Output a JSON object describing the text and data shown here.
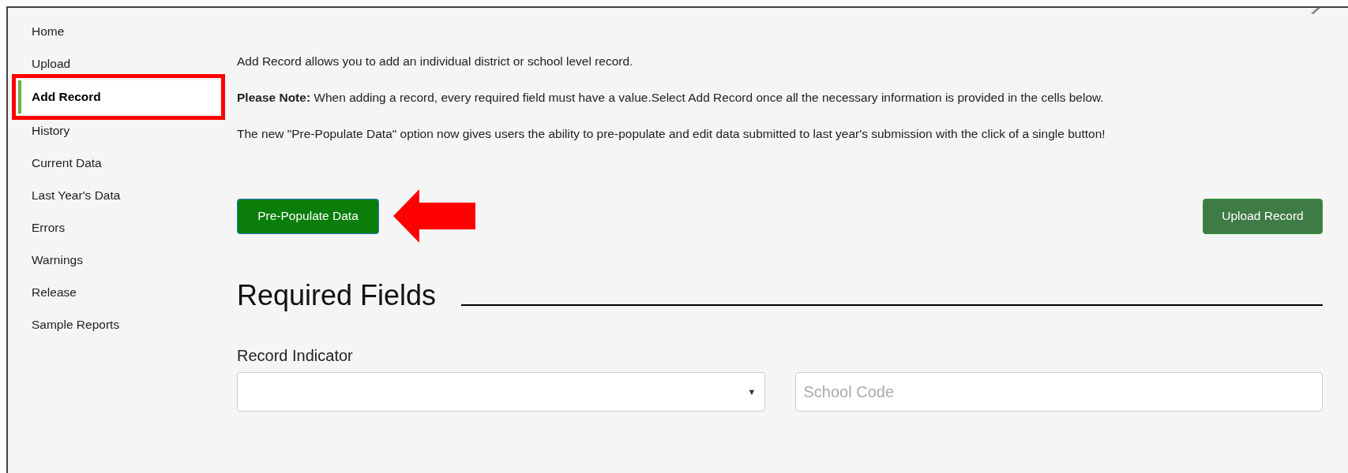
{
  "sidebar": {
    "items": [
      {
        "label": "Home",
        "selected": false
      },
      {
        "label": "Upload",
        "selected": false
      },
      {
        "label": "Add Record",
        "selected": true
      },
      {
        "label": "History",
        "selected": false
      },
      {
        "label": "Current Data",
        "selected": false
      },
      {
        "label": "Last Year's Data",
        "selected": false
      },
      {
        "label": "Errors",
        "selected": false
      },
      {
        "label": "Warnings",
        "selected": false
      },
      {
        "label": "Release",
        "selected": false
      },
      {
        "label": "Sample Reports",
        "selected": false
      }
    ]
  },
  "intro": [
    "Add Record allows you to add an individual district or school level record.",
    "**Please Note:** When adding a record, every required field must have a value.Select Add Record once all the necessary information is provided in the cells below.",
    "The new \"Pre-Populate Data\" option now gives users the ability to pre-populate and edit data submitted to last year's submission with the click of a single button!"
  ],
  "buttons": {
    "prepopulate": "Pre-Populate Data",
    "upload": "Upload Record"
  },
  "section": {
    "title": "Required Fields",
    "fields": [
      {
        "kind": "select",
        "label": "Record Indicator",
        "arrow": "▼"
      },
      {
        "kind": "input",
        "placeholder": "School Code"
      }
    ]
  }
}
